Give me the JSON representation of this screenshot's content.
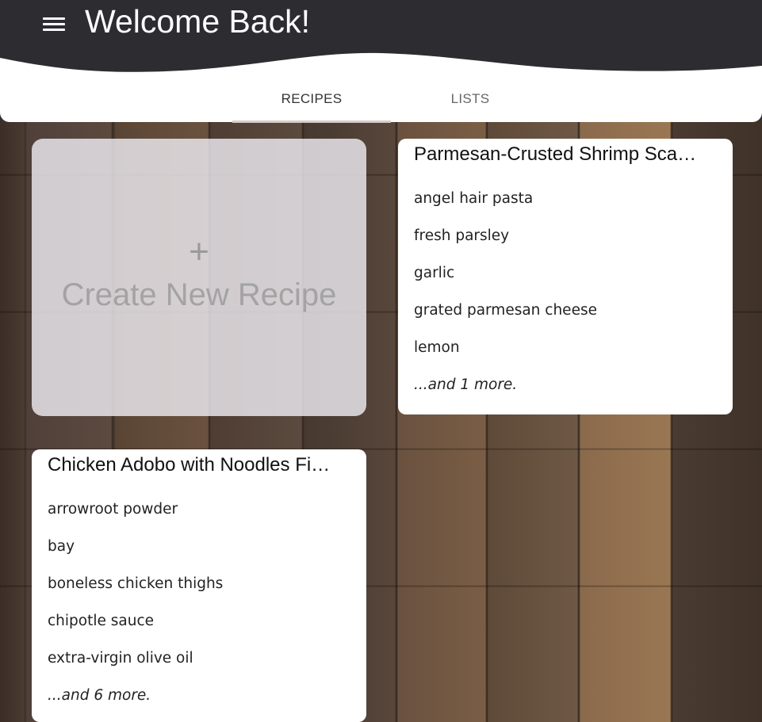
{
  "header": {
    "title": "Welcome Back!",
    "menu_icon": "hamburger-menu-icon",
    "background": "#2c2c31"
  },
  "tabs": [
    {
      "label": "RECIPES",
      "active": true
    },
    {
      "label": "LISTS",
      "active": false
    }
  ],
  "create_card": {
    "plus": "+",
    "label": "Create New Recipe"
  },
  "recipes": [
    {
      "title": "Parmesan-Crusted Shrimp Sca…",
      "ingredients": [
        "angel hair pasta",
        "fresh parsley",
        "garlic",
        "grated parmesan cheese",
        "lemon"
      ],
      "more": "...and 1 more."
    },
    {
      "title": "Chicken Adobo with Noodles Fi…",
      "ingredients": [
        "arrowroot powder",
        "bay",
        "boneless chicken thighs",
        "chipotle sauce",
        "extra-virgin olive oil"
      ],
      "more": "...and 6 more."
    }
  ]
}
